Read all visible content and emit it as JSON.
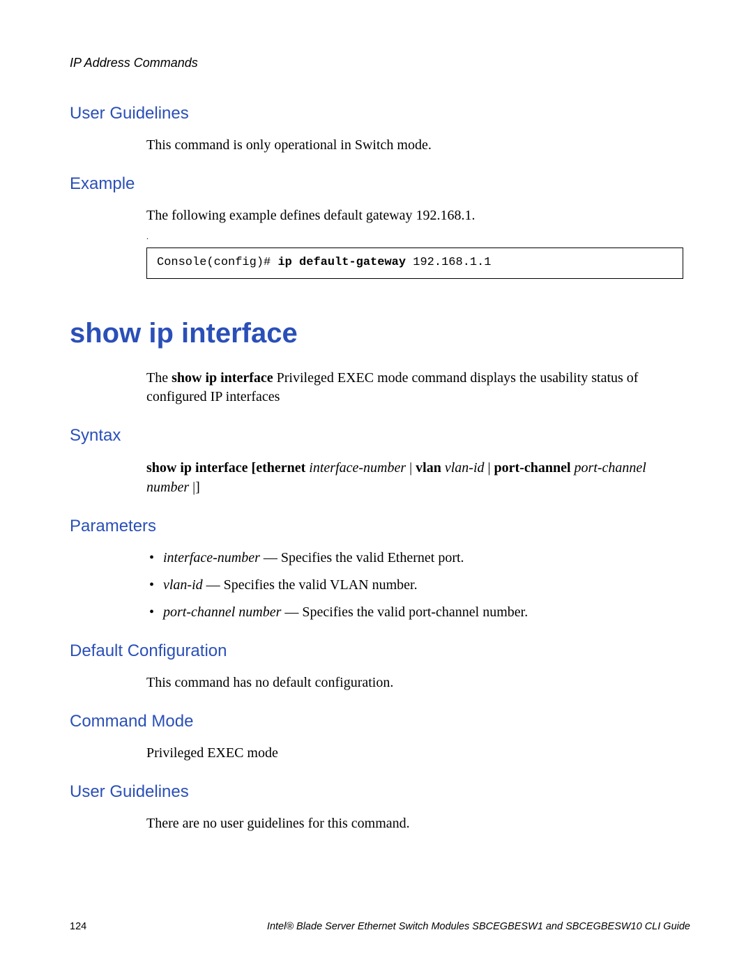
{
  "running_head": "IP Address Commands",
  "sec1": {
    "h": "User Guidelines",
    "p": "This command is only operational in Switch mode."
  },
  "sec2": {
    "h": "Example",
    "p": "The following example defines default gateway 192.168.1.",
    "dot": ".",
    "code_prefix": "Console(config)# ",
    "code_cmd": "ip default-gateway",
    "code_suffix": " 192.168.1.1"
  },
  "command": {
    "h": "show ip interface",
    "intro_before": "The ",
    "intro_bold": "show ip interface",
    "intro_after": " Privileged EXEC mode command displays the usability status of configured IP interfaces"
  },
  "syntax": {
    "h": "Syntax",
    "b1": "show ip interface ",
    "brk": "[",
    "b2": "ethernet ",
    "i1": "interface-number",
    "sep1": " | ",
    "b3": "vlan ",
    "i2": "vlan-id",
    "sep2": " | ",
    "b4": "port-channel ",
    "i3": "port-channel number",
    "tail": " |]"
  },
  "params": {
    "h": "Parameters",
    "items": [
      {
        "term": "interface-number",
        "desc": " — Specifies the valid Ethernet port."
      },
      {
        "term": "vlan-id",
        "desc": " — Specifies the valid VLAN number."
      },
      {
        "term": "port-channel number",
        "desc": " — Specifies the valid port-channel number."
      }
    ]
  },
  "defcfg": {
    "h": "Default Configuration",
    "p": "This command has no default configuration."
  },
  "cmode": {
    "h": "Command Mode",
    "p": "Privileged EXEC mode"
  },
  "ug2": {
    "h": "User Guidelines",
    "p": "There are no user guidelines for this command."
  },
  "footer": {
    "page": "124",
    "title": "Intel® Blade Server Ethernet Switch Modules SBCEGBESW1 and SBCEGBESW10 CLI Guide"
  }
}
